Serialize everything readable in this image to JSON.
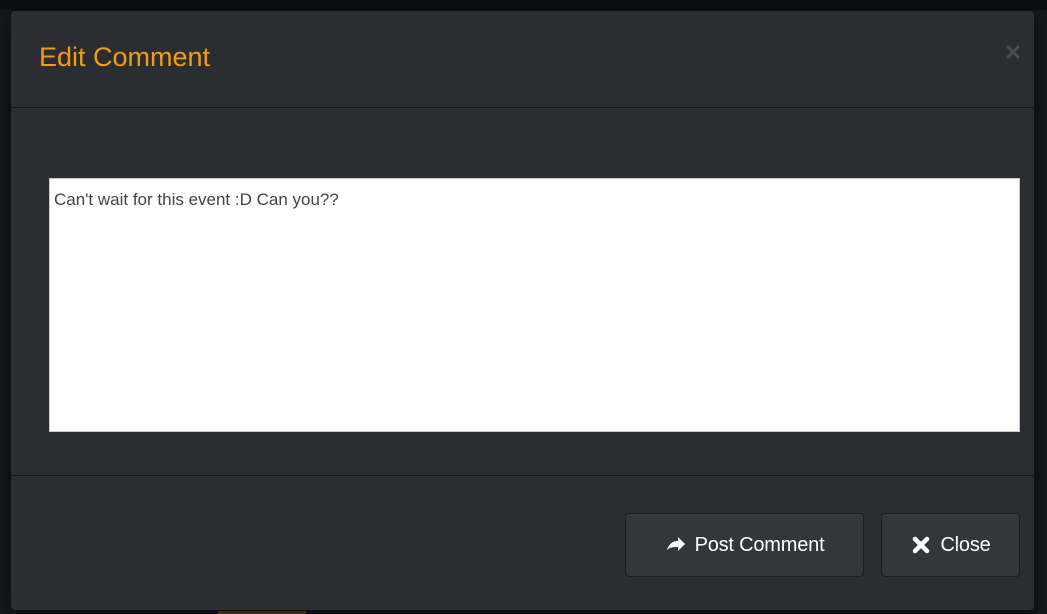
{
  "modal": {
    "title": "Edit Comment",
    "close_icon": "close-icon",
    "comment": {
      "value": "Can't wait for this event :D Can you??"
    },
    "buttons": {
      "post": {
        "label": "Post Comment",
        "icon": "arrow-right-icon"
      },
      "close": {
        "label": "Close",
        "icon": "x-icon"
      }
    }
  },
  "colors": {
    "title": "#f39c12",
    "modal_bg": "#2a2d32",
    "button_bg": "#33373d"
  }
}
